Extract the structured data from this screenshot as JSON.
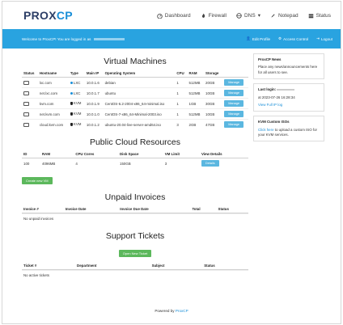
{
  "brand": {
    "name_a": "PROX",
    "name_b": "CP"
  },
  "nav": {
    "dashboard": "Dashboard",
    "firewall": "Firewall",
    "dns": "DNS",
    "notepad": "Notepad",
    "status": "Status"
  },
  "bar": {
    "welcome": "Welcome to ProxCP! You are logged in as",
    "edit_profile": "Edit Profile",
    "access_control": "Access Control",
    "logout": "Logout"
  },
  "vm": {
    "title": "Virtual Machines",
    "headers": [
      "Status",
      "Hostname",
      "Type",
      "Main IP",
      "Operating System",
      "CPU",
      "RAM",
      "Storage",
      ""
    ],
    "rows": [
      {
        "hostname": "lxc.com",
        "type": "LXC",
        "ip": "10.0.1.6",
        "os": "debian",
        "cpu": "1",
        "ram": "512MB",
        "storage": "20GB",
        "action": "Manage"
      },
      {
        "hostname": "net.lxc.com",
        "type": "LXC",
        "ip": "10.0.1.7",
        "os": "ubuntu",
        "cpu": "1",
        "ram": "512MB",
        "storage": "10GB",
        "action": "Manage"
      },
      {
        "hostname": "kvm.com",
        "type": "KVM",
        "ip": "10.0.1.9",
        "os": "CentOS-6.2-2004-x86_64-minimal.iso",
        "cpu": "1",
        "ram": "1GB",
        "storage": "30GB",
        "action": "Manage"
      },
      {
        "hostname": "net.kvm.com",
        "type": "KVM",
        "ip": "10.0.1.0",
        "os": "CentOS-7-x86_64-Minimal-2003.iso",
        "cpu": "1",
        "ram": "512MB",
        "storage": "10GB",
        "action": "Manage"
      },
      {
        "hostname": "cloud.kvm.com",
        "type": "KVM",
        "ip": "10.0.1.2",
        "os": "ubuntu-20.04-live-server-amd64.iso",
        "cpu": "3",
        "ram": "2GB",
        "storage": "47GB",
        "action": "Manage"
      }
    ]
  },
  "cloud": {
    "title": "Public Cloud Resources",
    "headers": [
      "ID",
      "RAM",
      "CPU Cores",
      "Disk Space",
      "VM Limit",
      "View Details"
    ],
    "rows": [
      {
        "id": "100",
        "ram": "4096MB",
        "cpu": "4",
        "disk": "150GB",
        "limit": "3",
        "action": "Details"
      }
    ],
    "create": "Create new VM"
  },
  "invoices": {
    "title": "Unpaid Invoices",
    "headers": [
      "Invoice #",
      "Invoice Date",
      "Invoice Due Date",
      "Total",
      "Status"
    ],
    "empty": "No unpaid invoices"
  },
  "tickets": {
    "title": "Support Tickets",
    "open": "Open New Ticket",
    "headers": [
      "Ticket #",
      "Department",
      "Subject",
      "Status"
    ],
    "empty": "No active tickets"
  },
  "news": {
    "title": "ProxCP News",
    "body": "Place any news/announcements here for all users to see."
  },
  "login": {
    "title": "Last login:",
    "at": "at 2023-07-26 16:28:34",
    "link": "View Full IP log"
  },
  "iso": {
    "title": "KVM Custom ISOs",
    "link": "Click here",
    "body": "to upload a custom ISO for your KVM services."
  },
  "footer": {
    "text": "Powered by",
    "link": "ProxCP"
  }
}
